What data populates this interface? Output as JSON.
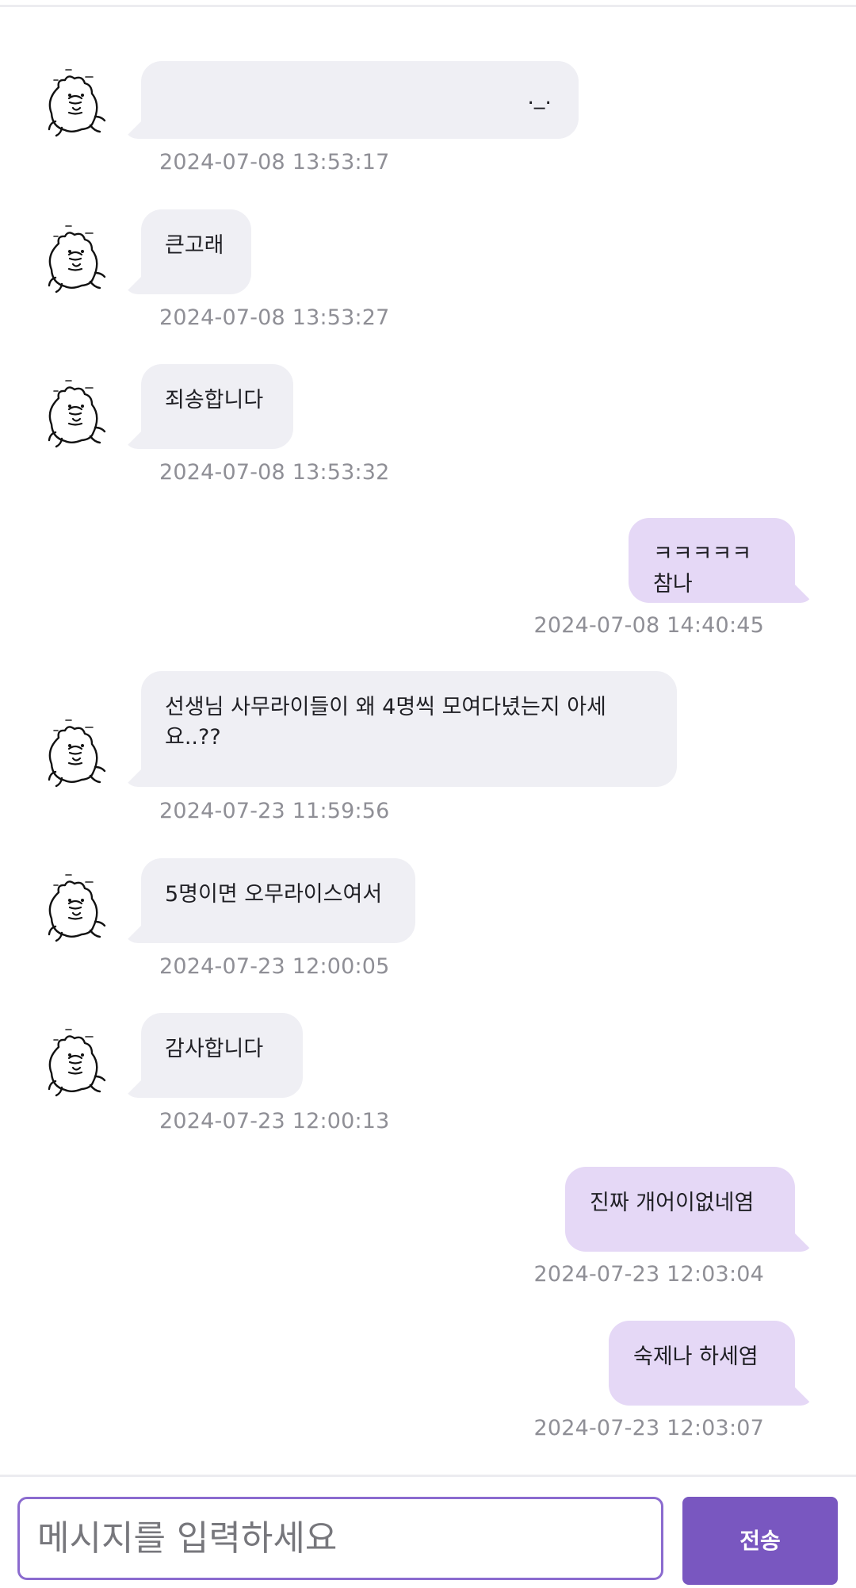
{
  "chat": {
    "messages": [
      {
        "sender": "other",
        "text": "._.",
        "timestamp": "2024-07-08 13:53:17"
      },
      {
        "sender": "other",
        "text": "큰고래",
        "timestamp": "2024-07-08 13:53:27"
      },
      {
        "sender": "other",
        "text": "죄송합니다",
        "timestamp": "2024-07-08 13:53:32"
      },
      {
        "sender": "me",
        "text": "ㅋㅋㅋㅋㅋ참나",
        "timestamp": "2024-07-08 14:40:45"
      },
      {
        "sender": "other",
        "text": "선생님 사무라이들이 왜 4명씩 모여다녔는지 아세요..??",
        "timestamp": "2024-07-23 11:59:56"
      },
      {
        "sender": "other",
        "text": "5명이면 오무라이스여서",
        "timestamp": "2024-07-23 12:00:05"
      },
      {
        "sender": "other",
        "text": "감사합니다",
        "timestamp": "2024-07-23 12:00:13"
      },
      {
        "sender": "me",
        "text": "진짜 개어이없네염",
        "timestamp": "2024-07-23 12:03:04"
      },
      {
        "sender": "me",
        "text": "숙제나 하세염",
        "timestamp": "2024-07-23 12:03:07"
      }
    ]
  },
  "composer": {
    "placeholder": "메시지를 입력하세요",
    "send_label": "전송"
  },
  "colors": {
    "other_bubble": "#efeff4",
    "my_bubble": "#e5d8f6",
    "accent": "#7957c0",
    "timestamp": "#8f8f96"
  },
  "icons": {
    "avatar": "bear-avatar-icon"
  }
}
